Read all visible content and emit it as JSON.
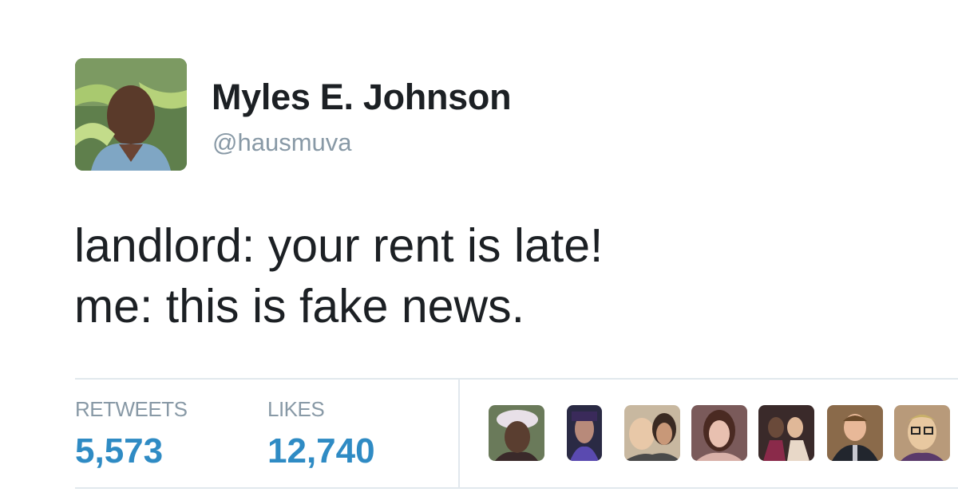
{
  "tweet": {
    "author": {
      "display_name": "Myles E. Johnson",
      "handle": "@hausmuva",
      "avatar_icon": "profile-photo"
    },
    "text_lines": [
      "landlord: your rent is late!",
      "me: this is fake news."
    ],
    "stats": {
      "retweets_label": "RETWEETS",
      "retweets_count": "5,573",
      "likes_label": "LIKES",
      "likes_count": "12,740"
    },
    "likers_count_shown": 7
  },
  "colors": {
    "stat_number": "#2f8bc4",
    "stat_label": "#8899a6",
    "handle": "#8899a6",
    "text": "#1c2024",
    "divider": "#e1e8ed"
  }
}
